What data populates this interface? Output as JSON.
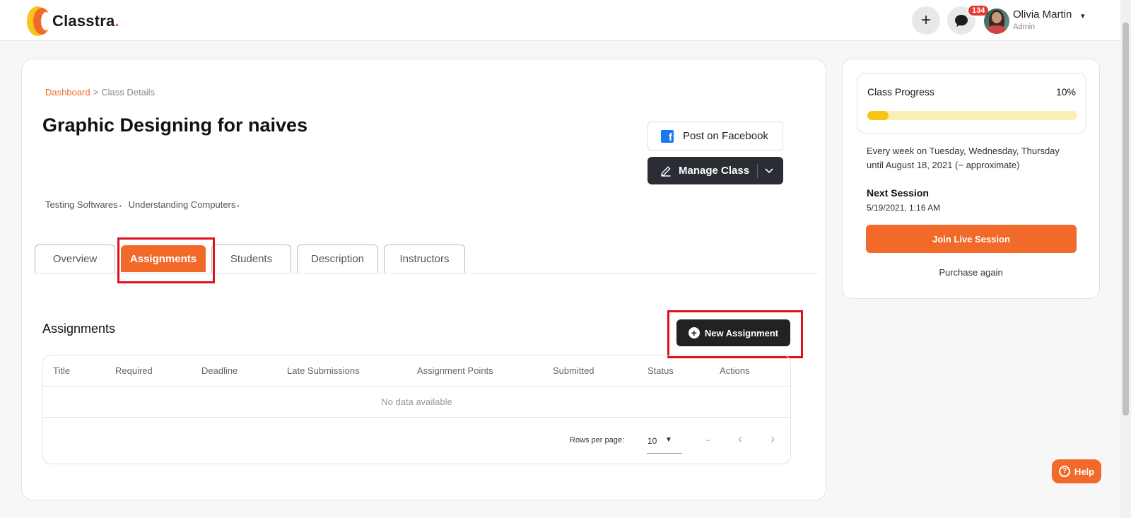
{
  "header": {
    "logo_text": "Classtra",
    "logo_dot": ".",
    "add_icon": "+",
    "messages_icon": "chat-icon",
    "messages_count": "134",
    "user_name": "Olivia Martin",
    "user_role": "Admin",
    "user_caret": "▾"
  },
  "breadcrumb": {
    "link": "Dashboard",
    "separator": ">",
    "current": "Class Details"
  },
  "page": {
    "title": "Graphic Designing for naives",
    "tags": [
      "Testing Softwares",
      "Understanding Computers"
    ]
  },
  "actions": {
    "facebook_label": "Post on Facebook",
    "manage_label": "Manage Class"
  },
  "tabs": [
    {
      "label": "Overview",
      "active": false
    },
    {
      "label": "Assignments",
      "active": true
    },
    {
      "label": "Students",
      "active": false
    },
    {
      "label": "Description",
      "active": false
    },
    {
      "label": "Instructors",
      "active": false
    }
  ],
  "assignments": {
    "section_title": "Assignments",
    "new_button_label": "New Assignment",
    "columns": [
      "Title",
      "Required",
      "Deadline",
      "Late Submissions",
      "Assignment Points",
      "Submitted",
      "Status",
      "Actions"
    ],
    "empty_text": "No data available",
    "rows_per_page_label": "Rows per page:",
    "rows_per_page_value": "10",
    "page_range": "–"
  },
  "side": {
    "progress_label": "Class Progress",
    "progress_percent": "10%",
    "progress_value": 0.1,
    "schedule_line1": "Every week on Tuesday, Wednesday, Thursday",
    "schedule_line2": "until August 18, 2021 (~ approximate)",
    "next_session_title": "Next Session",
    "next_session_date": "5/19/2021, 1:16 AM",
    "join_label": "Join Live Session",
    "purchase_label": "Purchase again"
  },
  "help_label": "Help",
  "colors": {
    "brand_orange": "#f26a2a",
    "brand_yellow": "#f5c518",
    "dark_button": "#2a2d33",
    "highlight_red": "#e0101e"
  }
}
